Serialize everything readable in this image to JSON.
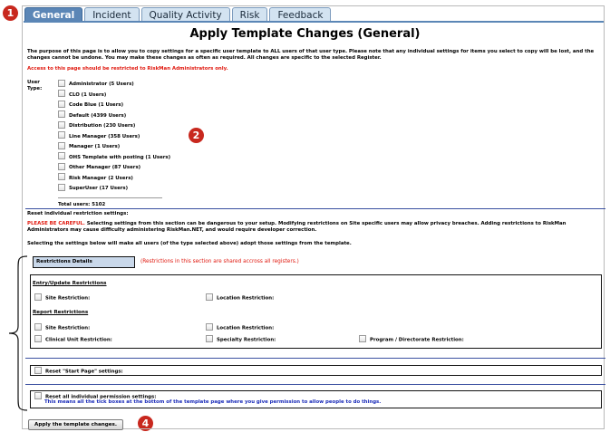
{
  "callouts": [
    "1",
    "2",
    "4"
  ],
  "tabs": {
    "general": "General",
    "incident": "Incident",
    "quality": "Quality Activity",
    "risk": "Risk",
    "feedback": "Feedback"
  },
  "page": {
    "title": "Apply Template Changes (General)",
    "intro": "The purpose of this page is to allow you to copy settings for a specific user template to ALL users of that user type. Please note that any individual settings for items you select to copy will be lost, and the changes cannot be undone. You may make these changes as often as required. All changes are specific to the selected Register.",
    "restricted_note": "Access to this page should be restricted to RiskMan Administrators only.",
    "user_type_label": "User Type:",
    "user_types": [
      "Administrator (5 Users)",
      "CLO (1 Users)",
      "Code Blue (1 Users)",
      "Default (4399 Users)",
      "Distribution (230 Users)",
      "Line Manager (358 Users)",
      "Manager (1 Users)",
      "OHS Template with posting (1 Users)",
      "Other Manager (87 Users)",
      "Risk Manager (2 Users)",
      "SuperUser (17 Users)"
    ],
    "total_users": "Total users: 5102",
    "reset_heading": "Reset individual restriction settings:",
    "careful_lead": "PLEASE BE CAREFUL.",
    "careful_text": " Selecting settings from this section can be dangerous to your setup. Modifying restrictions on Site specific users may allow privacy breaches. Adding restrictions to RiskMan Administrators may cause difficulty administering RiskMan.NET, and would require developer correction.",
    "selecting_text": "Selecting the settings below will make all users (of the type selected above) adopt those settings from the template.",
    "restrictions_details": "Restrictions Details",
    "restrictions_note": "(Restrictions in this section are shared accross all registers.)",
    "entry_heading": "Entry/Update Restrictions",
    "report_heading": "Report Restrictions",
    "site_restriction": "Site Restriction:",
    "location_restriction": "Location Restriction:",
    "clinical_unit_restriction": "Clinical Unit Restriction:",
    "specialty_restriction": "Specialty Restriction:",
    "program_restriction": "Program / Directorate Restriction:",
    "reset_start_page": "Reset \"Start Page\" settings:",
    "reset_permissions": "Reset all individual permission settings:",
    "reset_permissions_note": "This means all the tick boxes at the bottom of the template page where you give permission to allow people to do things.",
    "apply_button": "Apply the template changes."
  },
  "colors": {
    "accent_blue": "#5b86b6",
    "warning_red": "#e0190f",
    "callout_red": "#c8281e",
    "note_blue": "#1a2bb8"
  }
}
